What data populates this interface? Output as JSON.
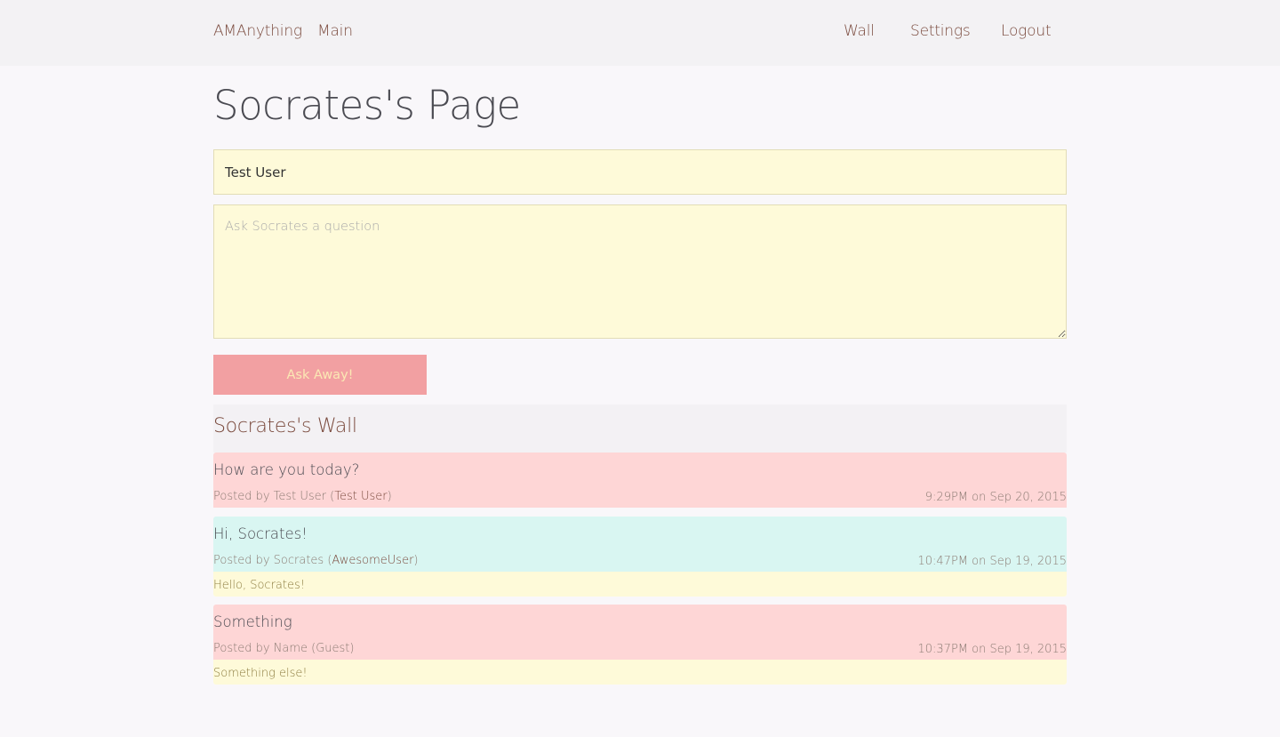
{
  "nav": {
    "brand": "AMAnything",
    "main": "Main",
    "wall": "Wall",
    "settings": "Settings",
    "logout": "Logout"
  },
  "page": {
    "title": "Socrates's Page"
  },
  "form": {
    "name_value": "Test User",
    "question_placeholder": "Ask Socrates a question",
    "submit_label": "Ask Away!"
  },
  "wall": {
    "title": "Socrates's Wall",
    "posts": [
      {
        "question": "How are you today?",
        "posted_by_prefix": "Posted by Test User (",
        "username": "Test User",
        "posted_by_suffix": ")",
        "time": "9:29PM on Sep 20, 2015",
        "color": "#fed6d6"
      },
      {
        "question": "Hi, Socrates!",
        "posted_by_prefix": "Posted by Socrates (",
        "username": "AwesomeUser",
        "posted_by_suffix": ")",
        "time": "10:47PM on Sep 19, 2015",
        "reply": "Hello, Socrates!",
        "color": "#d9f6f2"
      },
      {
        "question": "Something",
        "posted_by": "Posted by Name (Guest)",
        "time": "10:37PM on Sep 19, 2015",
        "reply": "Something else!",
        "color": "#fed6d6"
      }
    ]
  },
  "colors": {
    "accent_text": "#7a4a3d",
    "button_bg": "#f2a0a2",
    "input_bg": "#fefad9",
    "navbar_bg": "#f3f2f4",
    "page_bg": "#f9f7fa"
  }
}
